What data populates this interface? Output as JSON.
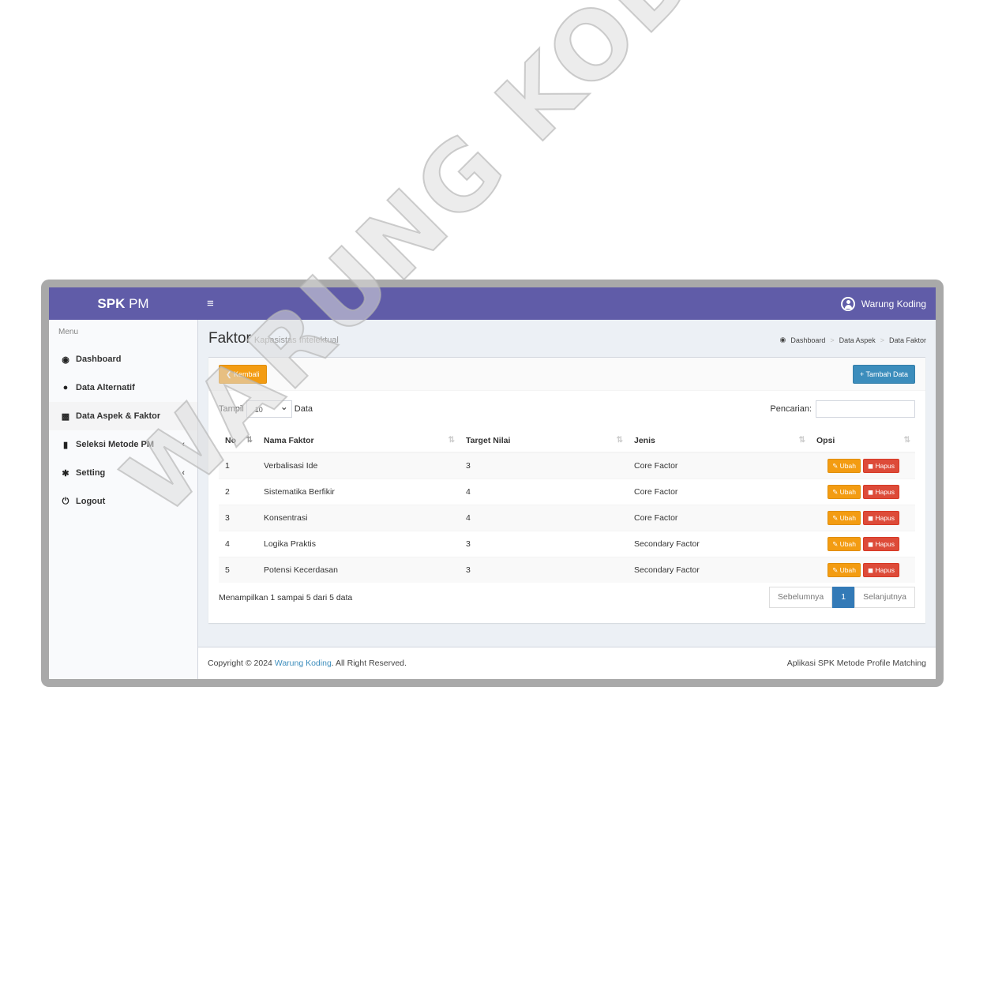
{
  "header": {
    "logo_bold": "SPK",
    "logo_rest": " PM",
    "toggle": "≡",
    "user": "Warung Koding"
  },
  "sidebar": {
    "heading": "Menu",
    "items": [
      {
        "label": "Dashboard",
        "icon": "dashboard-icon",
        "glyph": "🚗"
      },
      {
        "label": "Data Alternatif",
        "icon": "users-icon",
        "glyph": "👥"
      },
      {
        "label": "Data Aspek & Faktor",
        "icon": "cubes-icon",
        "glyph": "⚙"
      },
      {
        "label": "Seleksi Metode PM",
        "icon": "chart-icon",
        "glyph": "📊"
      },
      {
        "label": "Setting",
        "icon": "gear-icon",
        "glyph": "⚙"
      },
      {
        "label": "Logout",
        "icon": "power-icon",
        "glyph": "⏻"
      }
    ],
    "chevron": "‹"
  },
  "content": {
    "title": "Faktor",
    "subtitle": "Kapasistas Intelektual",
    "breadcrumb": [
      "Dashboard",
      "Data Aspek",
      "Data Faktor"
    ],
    "crumb_sep": ">"
  },
  "box": {
    "back_label": "Kembali",
    "add_label": "Tambah Data",
    "show_label": "Tampil",
    "show_value": "10",
    "show_suffix": "Data",
    "search_label": "Pencarian:"
  },
  "table": {
    "columns": [
      "No",
      "Nama Faktor",
      "Target Nilai",
      "Jenis",
      "Opsi"
    ],
    "rows": [
      {
        "no": "1",
        "nama": "Verbalisasi Ide",
        "target": "3",
        "jenis": "Core Factor"
      },
      {
        "no": "2",
        "nama": "Sistematika Berfikir",
        "target": "4",
        "jenis": "Core Factor"
      },
      {
        "no": "3",
        "nama": "Konsentrasi",
        "target": "4",
        "jenis": "Core Factor"
      },
      {
        "no": "4",
        "nama": "Logika Praktis",
        "target": "3",
        "jenis": "Secondary Factor"
      },
      {
        "no": "5",
        "nama": "Potensi Kecerdasan",
        "target": "3",
        "jenis": "Secondary Factor"
      }
    ],
    "edit_label": "Ubah",
    "delete_label": "Hapus"
  },
  "pagination": {
    "info": "Menampilkan 1 sampai 5 dari 5 data",
    "prev": "Sebelumnya",
    "current": "1",
    "next": "Selanjutnya"
  },
  "footer": {
    "copy_prefix": "Copyright © 2024 ",
    "copy_link": "Warung Koding",
    "copy_suffix": ". All Right Reserved.",
    "right": "Aplikasi SPK Metode Profile Matching"
  },
  "watermark": "WARUNG KODING",
  "colors": {
    "header": "#605ca8",
    "warning": "#f39c12",
    "danger": "#dd4b39",
    "info": "#3c8dbc"
  }
}
